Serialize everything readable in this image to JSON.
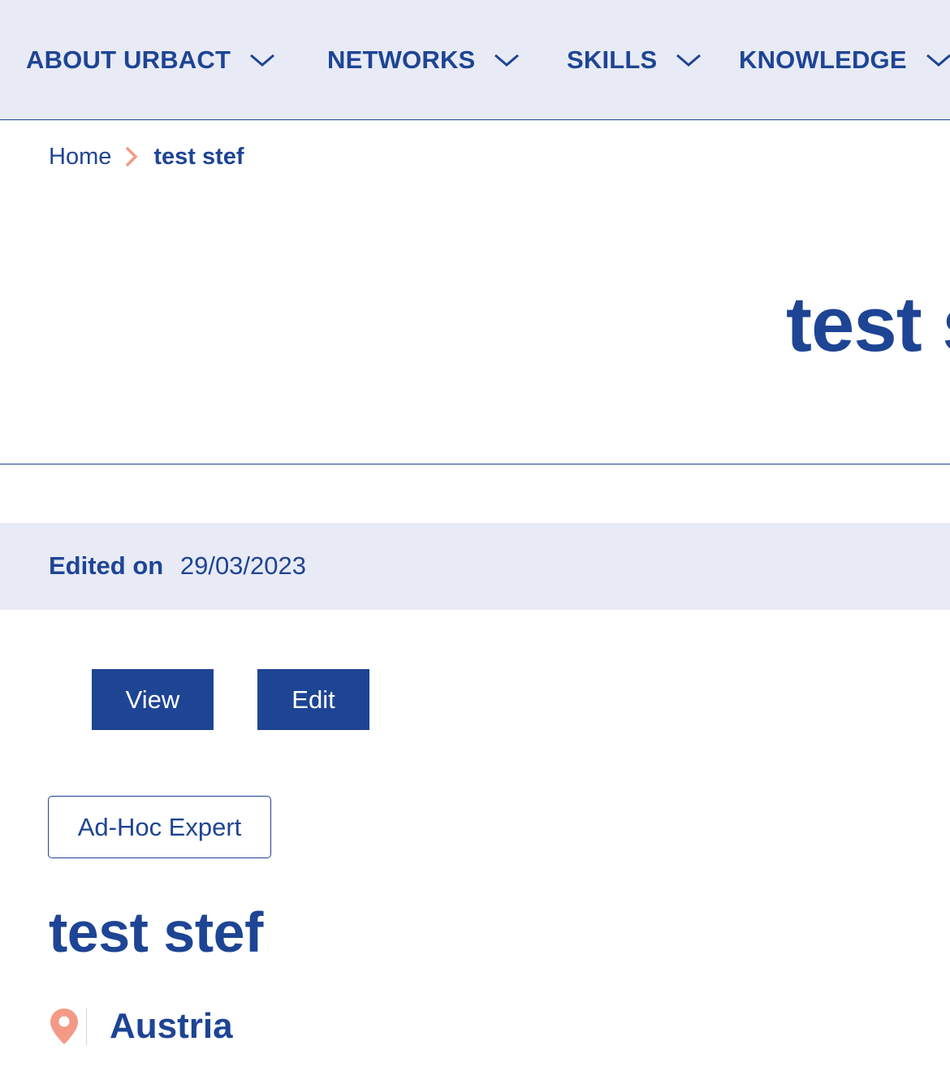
{
  "nav": {
    "items": [
      {
        "label": "ABOUT URBACT",
        "icon": "chevron-down-icon"
      },
      {
        "label": "NETWORKS",
        "icon": "chevron-down-icon"
      },
      {
        "label": "SKILLS",
        "icon": "chevron-down-icon"
      },
      {
        "label": "KNOWLEDGE",
        "icon": "chevron-down-icon"
      }
    ]
  },
  "breadcrumb": {
    "home": "Home",
    "separator_icon": "chevron-right-icon",
    "current": "test stef"
  },
  "hero": {
    "title": "test stef"
  },
  "meta": {
    "edited_label": "Edited on",
    "edited_date": "29/03/2023"
  },
  "tabs": {
    "view": "View",
    "edit": "Edit"
  },
  "profile": {
    "role": "Ad-Hoc Expert",
    "name": "test stef",
    "location_icon": "map-pin-icon",
    "location": "Austria"
  },
  "colors": {
    "primary": "#1e4494",
    "light_bg": "#e8ebf5",
    "accent": "#f39a86"
  }
}
